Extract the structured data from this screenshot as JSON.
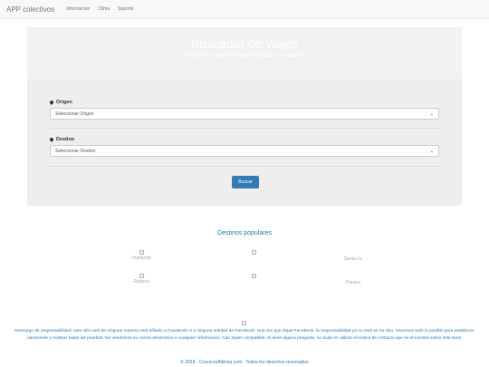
{
  "navbar": {
    "brand": "APP colectivos",
    "links": [
      "Informacion",
      "Clima",
      "Soporte"
    ]
  },
  "hero": {
    "title": "Buscador de viajes",
    "subtitle": "Encontrá tu viaje en transporte público al instante"
  },
  "form": {
    "origin_label": "Origen",
    "origin_value": "Seleccionar Origen",
    "destination_label": "Destino",
    "destination_value": "Seleccionar Destino",
    "search_button": "Buscar"
  },
  "popular": {
    "title": "Destinos populares",
    "items": [
      "Humboldt",
      "",
      "Santa Fe",
      "Rafaela",
      "",
      "Parana"
    ]
  },
  "footer": {
    "disclaimer": "Descargo de responsabilidad: este sitio web de ninguna manera está afiliado a FaceBook ni a ninguna entidad de FaceBook. Una vez que dejas FaceBook, la responsabilidad ya no está en su sitio. Hacemos todo lo posible para establecer claramente y mostrar todas las pruebas. No vendemos su correo electrónico o cualquier información. Can Spam compatible. Si tiene alguna pregunta, no dude en utilizar el enlace de contacto que se encuentra sobre este texto.",
    "copyright": "© 2018 - CrucerosAlkimia.com - Todos los derechos reservados"
  },
  "colors": {
    "accent": "#337ab7",
    "link_text": "#2a7ab0",
    "hero_bg": "#eeeeee"
  }
}
